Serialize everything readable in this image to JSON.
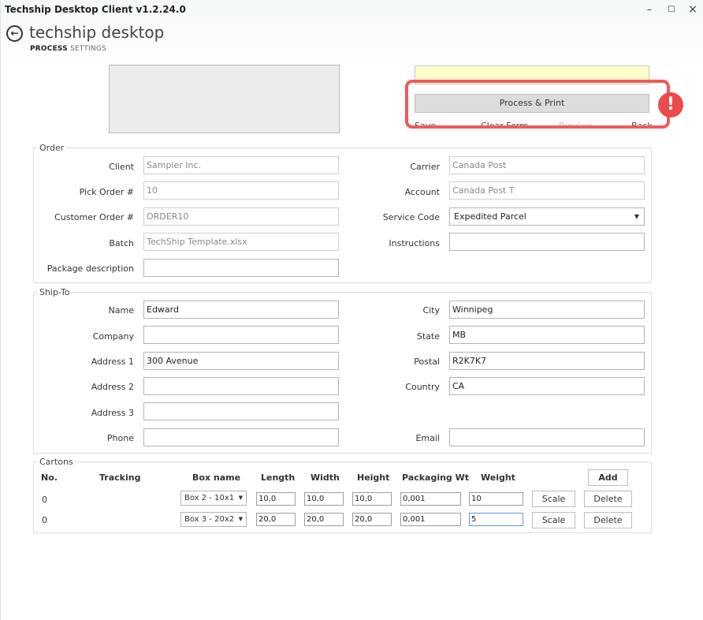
{
  "window": {
    "title": "Techship Desktop Client v1.2.24.0",
    "controls": {
      "minimize": "–",
      "maximize": "□",
      "close": "×"
    }
  },
  "header": {
    "back_icon": "arrow-left-icon",
    "brand": "techship desktop",
    "tabs": [
      {
        "label": "PROCESS",
        "active": true
      },
      {
        "label": "SETTINGS",
        "active": false
      }
    ]
  },
  "actions": {
    "process_print": "Process & Print",
    "save": "Save",
    "clear_form": "Clear Form",
    "preview": "Preview",
    "back": "Back",
    "alert_icon": "!"
  },
  "order": {
    "legend": "Order",
    "client": {
      "label": "Client",
      "value": "Sampler Inc."
    },
    "pick_order": {
      "label": "Pick Order #",
      "value": "10"
    },
    "customer_order": {
      "label": "Customer Order #",
      "value": "ORDER10"
    },
    "batch": {
      "label": "Batch",
      "value": "TechShip Template.xlsx"
    },
    "package_description": {
      "label": "Package description",
      "value": ""
    },
    "carrier": {
      "label": "Carrier",
      "value": "Canada Post"
    },
    "account": {
      "label": "Account",
      "value": "Canada Post T"
    },
    "service_code": {
      "label": "Service Code",
      "value": "Expedited Parcel"
    },
    "instructions": {
      "label": "Instructions",
      "value": ""
    }
  },
  "ship_to": {
    "legend": "Ship-To",
    "name": {
      "label": "Name",
      "value": "Edward"
    },
    "company": {
      "label": "Company",
      "value": ""
    },
    "address1": {
      "label": "Address 1",
      "value": "300  Avenue"
    },
    "address2": {
      "label": "Address 2",
      "value": ""
    },
    "address3": {
      "label": "Address 3",
      "value": ""
    },
    "phone": {
      "label": "Phone",
      "value": ""
    },
    "city": {
      "label": "City",
      "value": "Winnipeg"
    },
    "state": {
      "label": "State",
      "value": "MB"
    },
    "postal": {
      "label": "Postal",
      "value": "R2K7K7"
    },
    "country": {
      "label": "Country",
      "value": "CA"
    },
    "email": {
      "label": "Email",
      "value": ""
    }
  },
  "cartons": {
    "legend": "Cartons",
    "columns": [
      "No.",
      "Tracking",
      "Box name",
      "Length",
      "Width",
      "Height",
      "Packaging Wt",
      "Weight"
    ],
    "add_label": "Add",
    "rows": [
      {
        "no": "0",
        "tracking": "",
        "box": "Box 2 - 10x1",
        "length": "10,0",
        "width": "10,0",
        "height": "10,0",
        "packaging_wt": "0,001",
        "weight": "10",
        "scale": "Scale",
        "delete": "Delete"
      },
      {
        "no": "0",
        "tracking": "",
        "box": "Box 3 - 20x2",
        "length": "20,0",
        "width": "20,0",
        "height": "20,0",
        "packaging_wt": "0,001",
        "weight": "5",
        "scale": "Scale",
        "delete": "Delete"
      }
    ]
  },
  "colors": {
    "highlight": "#ef5a5a",
    "status_bg": "#ffffcc",
    "accent_focus": "#5b9bd5"
  }
}
